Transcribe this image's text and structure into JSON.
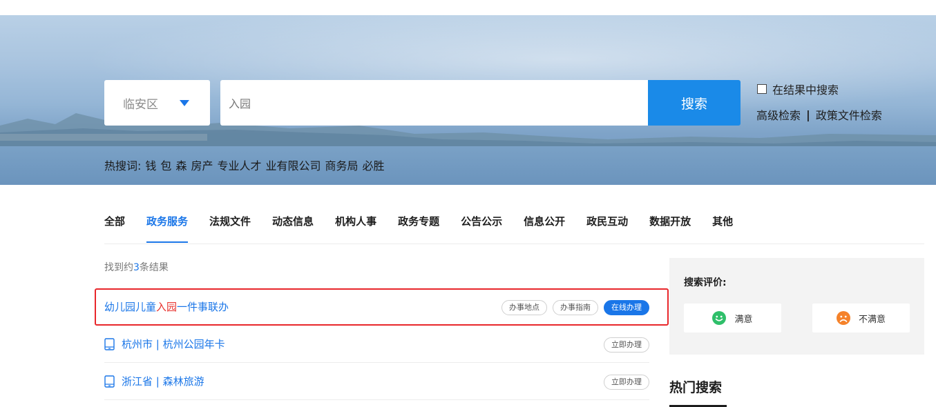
{
  "search": {
    "region": "临安区",
    "query": "入园",
    "button_label": "搜索",
    "within_results_label": "在结果中搜索",
    "advanced_label": "高级检索",
    "separator": "|",
    "policy_label": "政策文件检索",
    "hot_words_label": "热搜词:",
    "hot_words": [
      "钱",
      "包",
      "森",
      "房产",
      "专业人才",
      "业有限公司",
      "商务局",
      "必胜"
    ]
  },
  "tabs": [
    "全部",
    "政务服务",
    "法规文件",
    "动态信息",
    "机构人事",
    "政务专题",
    "公告公示",
    "信息公开",
    "政民互动",
    "数据开放",
    "其他"
  ],
  "active_tab": "政务服务",
  "results": {
    "count_prefix": "找到约",
    "count": "3",
    "count_suffix": "条结果",
    "items": [
      {
        "title_before": "幼儿园儿童",
        "title_highlight": "入园",
        "title_after": "一件事联办",
        "buttons": [
          "办事地点",
          "办事指南",
          "在线办理"
        ]
      },
      {
        "title": "杭州市 | 杭州公园年卡",
        "buttons": [
          "立即办理"
        ]
      },
      {
        "title": "浙江省 | 森林旅游",
        "buttons": [
          "立即办理"
        ]
      }
    ]
  },
  "evaluation": {
    "title": "搜索评价:",
    "satisfied": "满意",
    "unsatisfied": "不满意"
  },
  "hot_search": {
    "title": "热门搜索"
  },
  "colors": {
    "accent": "#1a76e8",
    "search_button": "#1a8ae8",
    "highlight": "#e8302c",
    "satisfied_face": "#2fbf6a",
    "unsatisfied_face": "#f5822a"
  },
  "icons": [
    "caret-down-icon",
    "checkbox-icon",
    "mobile-phone-icon",
    "smile-face-icon",
    "sad-face-icon"
  ]
}
